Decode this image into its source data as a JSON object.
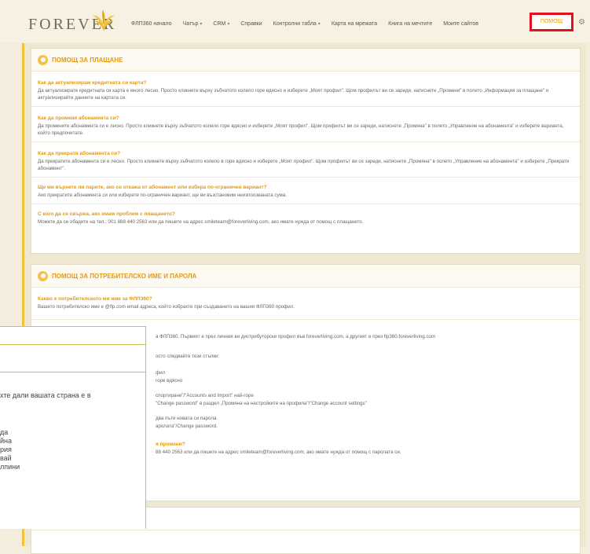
{
  "header": {
    "logo": "FOREVER",
    "nav": [
      {
        "label": "ФЛП360 начало",
        "caret": false
      },
      {
        "label": "Чатър",
        "caret": true
      },
      {
        "label": "CRM",
        "caret": true
      },
      {
        "label": "Справки",
        "caret": false
      },
      {
        "label": "Контролни табла",
        "caret": true
      },
      {
        "label": "Карта на мрежата",
        "caret": false
      },
      {
        "label": "Книга на мечтите",
        "caret": false
      },
      {
        "label": "Моите сайтов",
        "caret": false
      }
    ],
    "help": "ПОМОЩ"
  },
  "payment": {
    "title": "ПОМОЩ ЗА ПЛАЩАНЕ",
    "faqs": [
      {
        "q": "Как да актуализирам кредитната си карта?",
        "a": "Да актуализирате кредитната си карта е много лесно. Просто кликнете върху зъбчатото колело горе вдясно и изберете „Моят профил\". Щом профилът ви се зареди, натиснете „Промени\" в полето „Информация за плащане\" и актуализирайте данните на картата си."
      },
      {
        "q": "Как да променя абонамента си?",
        "a": "Да промените абонамента си е лесно. Просто кликнете върху зъбчатото колело горе вдясно и изберете „Моят профил\". Щом профилът ви се зареди, натиснете „Промяна\" в полето „Управление на абонамента\" и изберете варианта, който предпочитате."
      },
      {
        "q": "Как да прекратя абонамента си?",
        "a": "Да прекратите абонамента си е лесно. Просто кликнете върху зъбчатото колело в горе вдясно и изберете „Моят профил\". Щом профилът ви се зареди, натиснете „Промяна\" в полето „Управление на абонамента\" и изберете „Прекрати абонамент\"."
      },
      {
        "q": "Ще ми върнете ли парите, ако се откажа от абонамент или избера по-ограничен вариант?",
        "a": "Ако прекратите абонамента си или изберете по-ограничен вариант, ще ви възстановим неизползваната сума."
      },
      {
        "q": "С кого да се свържа, ако имам проблем с плащането?",
        "a": "Можете да се обадите на тел.: 001 888 440 2563 или да пишете на адрес smileteam@foreverliving.com, ако имате нужда от помощ с плащането."
      }
    ]
  },
  "account": {
    "title": "ПОМОЩ ЗА ПОТРЕБИТЕЛСКО ИМЕ И ПАРОЛА",
    "faqs": [
      {
        "q": "Какво е потребителското ми име за ФЛП360?",
        "a": "Вашето потребителско име е @flp.com email адреса, който избрахте при създаването на вашия ФЛП360 профил."
      }
    ],
    "fragments": [
      "а ФЛП360. Първият е през личния ви дистрибуторски профил във foreverliving.com, а другият е през flp360.foreverliving.com",
      "осто следвайте тези стъпки:",
      "фил",
      "горе вдясно",
      "спортиране\"/\"Accounts and Import\" най-горе",
      "\"Change password\" в раздел „Промяна на настройките на профила\"/\"Change account settings\"",
      "два пъти новата си парола.",
      "аролата\"/Change password.",
      "я промени?",
      "88 440 2563 или да пишете на адрес smileteam@foreverliving.com, ако имате нужда от помощ с паролата си."
    ]
  },
  "overlay": {
    "lines": [
      "хте дали вашата страна е в",
      "да",
      "йна",
      "рия",
      "вай",
      "лпини"
    ]
  }
}
